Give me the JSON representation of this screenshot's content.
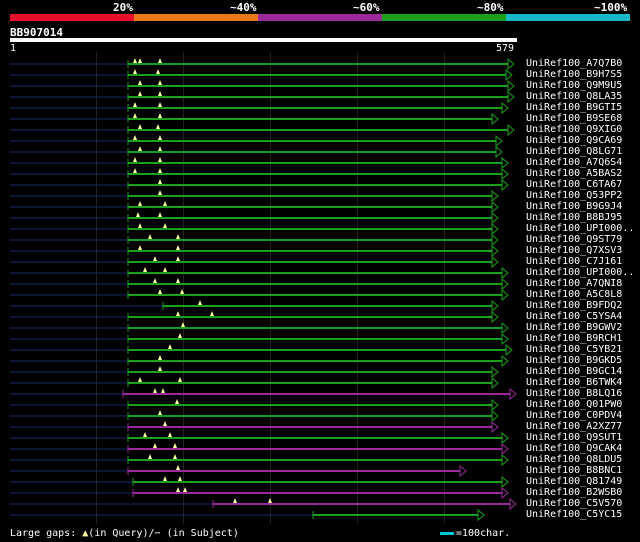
{
  "legend": {
    "labels": [
      "20%",
      "~40%",
      "~60%",
      "~80%",
      "~100%"
    ],
    "colors": [
      "#e8102a",
      "#e87818",
      "#9a2a9a",
      "#1aa01a",
      "#18b8c8"
    ]
  },
  "query": {
    "id": "BB907014",
    "start": "1",
    "end": "579"
  },
  "hits": [
    {
      "label": "UniRef100_A7Q7B0",
      "start": 128,
      "end": 514,
      "color": "green",
      "gaps": [
        160,
        135,
        140
      ]
    },
    {
      "label": "UniRef100_B9H7S5",
      "start": 128,
      "end": 512,
      "color": "green",
      "gaps": [
        158,
        135
      ]
    },
    {
      "label": "UniRef100_Q9M9U5",
      "start": 128,
      "end": 514,
      "color": "green",
      "gaps": [
        160,
        140
      ]
    },
    {
      "label": "UniRef100_Q8LA35",
      "start": 128,
      "end": 514,
      "color": "green",
      "gaps": [
        160,
        140
      ]
    },
    {
      "label": "UniRef100_B9GTI5",
      "start": 128,
      "end": 508,
      "color": "green",
      "gaps": [
        160,
        135
      ]
    },
    {
      "label": "UniRef100_B9SE68",
      "start": 128,
      "end": 498,
      "color": "green",
      "gaps": [
        160,
        135
      ]
    },
    {
      "label": "UniRef100_Q9XIG0",
      "start": 128,
      "end": 514,
      "color": "green",
      "gaps": [
        158,
        140
      ]
    },
    {
      "label": "UniRef100_Q9CA69",
      "start": 128,
      "end": 502,
      "color": "green",
      "gaps": [
        160,
        135
      ]
    },
    {
      "label": "UniRef100_Q8LG71",
      "start": 128,
      "end": 502,
      "color": "green",
      "gaps": [
        160,
        140
      ]
    },
    {
      "label": "UniRef100_A7Q6S4",
      "start": 128,
      "end": 508,
      "color": "green",
      "gaps": [
        160,
        135
      ]
    },
    {
      "label": "UniRef100_A5BAS2",
      "start": 128,
      "end": 508,
      "color": "green",
      "gaps": [
        160,
        135
      ]
    },
    {
      "label": "UniRef100_C6TA67",
      "start": 128,
      "end": 508,
      "color": "green",
      "gaps": [
        160
      ]
    },
    {
      "label": "UniRef100_Q53PP2",
      "start": 128,
      "end": 498,
      "color": "green",
      "gaps": [
        160
      ]
    },
    {
      "label": "UniRef100_B9G9J4",
      "start": 128,
      "end": 498,
      "color": "green",
      "gaps": [
        140,
        165
      ]
    },
    {
      "label": "UniRef100_B8BJ95",
      "start": 128,
      "end": 498,
      "color": "green",
      "gaps": [
        138,
        160
      ]
    },
    {
      "label": "UniRef100_UPI000..",
      "start": 128,
      "end": 498,
      "color": "green",
      "gaps": [
        140,
        165
      ]
    },
    {
      "label": "UniRef100_Q9ST79",
      "start": 128,
      "end": 498,
      "color": "green",
      "gaps": [
        150,
        178
      ]
    },
    {
      "label": "UniRef100_Q7XSV3",
      "start": 128,
      "end": 498,
      "color": "green",
      "gaps": [
        140,
        178
      ]
    },
    {
      "label": "UniRef100_C7J161",
      "start": 128,
      "end": 498,
      "color": "green",
      "gaps": [
        155,
        178
      ]
    },
    {
      "label": "UniRef100_UPI000..",
      "start": 128,
      "end": 508,
      "color": "green",
      "gaps": [
        145,
        165
      ]
    },
    {
      "label": "UniRef100_A7QNI8",
      "start": 128,
      "end": 508,
      "color": "green",
      "gaps": [
        155,
        178
      ]
    },
    {
      "label": "UniRef100_A5C8L8",
      "start": 128,
      "end": 508,
      "color": "green",
      "gaps": [
        160,
        182
      ]
    },
    {
      "label": "UniRef100_B9FDQ2",
      "start": 163,
      "end": 498,
      "color": "green",
      "gaps": [
        200
      ]
    },
    {
      "label": "UniRef100_C5YSA4",
      "start": 128,
      "end": 498,
      "color": "green",
      "gaps": [
        178,
        212
      ]
    },
    {
      "label": "UniRef100_B9GWV2",
      "start": 128,
      "end": 508,
      "color": "green",
      "gaps": [
        183
      ]
    },
    {
      "label": "UniRef100_B9RCH1",
      "start": 128,
      "end": 508,
      "color": "green",
      "gaps": [
        180
      ]
    },
    {
      "label": "UniRef100_C5YB21",
      "start": 128,
      "end": 512,
      "color": "green",
      "gaps": [
        170
      ]
    },
    {
      "label": "UniRef100_B9GKD5",
      "start": 128,
      "end": 508,
      "color": "green",
      "gaps": [
        160
      ]
    },
    {
      "label": "UniRef100_B9GC14",
      "start": 128,
      "end": 498,
      "color": "green",
      "gaps": [
        160
      ]
    },
    {
      "label": "UniRef100_B6TWK4",
      "start": 128,
      "end": 498,
      "color": "green",
      "gaps": [
        140,
        180
      ]
    },
    {
      "label": "UniRef100_B8LQ16",
      "start": 123,
      "end": 516,
      "color": "purple",
      "gaps": [
        155,
        163
      ]
    },
    {
      "label": "UniRef100_Q01PW0",
      "start": 128,
      "end": 498,
      "color": "green",
      "gaps": [
        177
      ]
    },
    {
      "label": "UniRef100_C0PDV4",
      "start": 128,
      "end": 498,
      "color": "green",
      "gaps": [
        160
      ]
    },
    {
      "label": "UniRef100_A2XZ77",
      "start": 128,
      "end": 498,
      "color": "purple",
      "gaps": [
        165
      ]
    },
    {
      "label": "UniRef100_Q9SUT1",
      "start": 128,
      "end": 508,
      "color": "green",
      "gaps": [
        145,
        170
      ]
    },
    {
      "label": "UniRef100_Q9CAK4",
      "start": 128,
      "end": 508,
      "color": "purple",
      "gaps": [
        155,
        175
      ]
    },
    {
      "label": "UniRef100_Q8LDU5",
      "start": 128,
      "end": 508,
      "color": "green",
      "gaps": [
        150,
        175
      ]
    },
    {
      "label": "UniRef100_B8BNC1",
      "start": 128,
      "end": 466,
      "color": "purple",
      "gaps": [
        178
      ]
    },
    {
      "label": "UniRef100_Q81749",
      "start": 133,
      "end": 508,
      "color": "green",
      "gaps": [
        165,
        180
      ]
    },
    {
      "label": "UniRef100_B2WSB0",
      "start": 133,
      "end": 508,
      "color": "purple",
      "gaps": [
        178,
        185
      ]
    },
    {
      "label": "UniRef100_C5V570",
      "start": 213,
      "end": 516,
      "color": "purple",
      "gaps": [
        235,
        270
      ]
    },
    {
      "label": "UniRef100_C5YC15",
      "start": 313,
      "end": 484,
      "color": "green",
      "gaps": []
    }
  ],
  "footer": {
    "gaps_label": "Large gaps:",
    "query_text": "(in Query)/",
    "subject_text": "(in Subject)",
    "scale_text": "=100char."
  }
}
